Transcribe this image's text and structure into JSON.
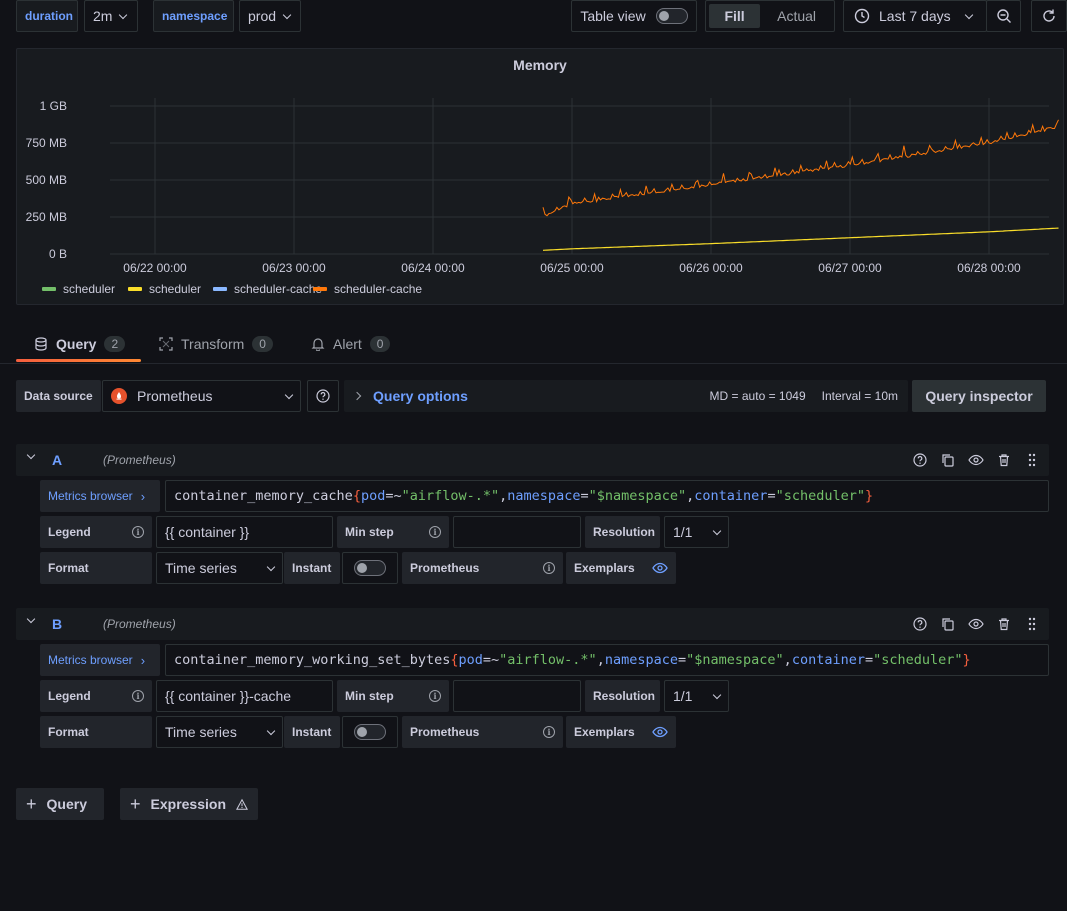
{
  "variables": [
    {
      "label": "duration",
      "value": "2m"
    },
    {
      "label": "namespace",
      "value": "prod"
    }
  ],
  "toolbar": {
    "table_view_label": "Table view",
    "fill_label": "Fill",
    "actual_label": "Actual",
    "time_range": "Last 7 days"
  },
  "panel": {
    "title": "Memory",
    "legend": [
      {
        "name": "scheduler",
        "color": "#73bf69"
      },
      {
        "name": "scheduler",
        "color": "#fade2a"
      },
      {
        "name": "scheduler-cache",
        "color": "#8ab8ff"
      },
      {
        "name": "scheduler-cache",
        "color": "#ff780a"
      }
    ]
  },
  "chart_data": {
    "type": "line",
    "title": "Memory",
    "y_ticks": [
      "1 GB",
      "750 MB",
      "500 MB",
      "250 MB",
      "0 B"
    ],
    "x_ticks": [
      "06/22 00:00",
      "06/23 00:00",
      "06/24 00:00",
      "06/25 00:00",
      "06/26 00:00",
      "06/27 00:00",
      "06/28 00:00"
    ],
    "ylim_mb": [
      0,
      1000
    ],
    "series": [
      {
        "name": "scheduler-cache",
        "color": "#ff780a",
        "x": [
          "06/24 19:00",
          "06/25 00:00",
          "06/26 00:00",
          "06/27 00:00",
          "06/28 00:00",
          "06/28 12:00"
        ],
        "values_mb": [
          255,
          340,
          470,
          600,
          750,
          860
        ]
      },
      {
        "name": "scheduler",
        "color": "#fade2a",
        "x": [
          "06/24 19:00",
          "06/25 00:00",
          "06/26 00:00",
          "06/27 00:00",
          "06/28 00:00",
          "06/28 12:00"
        ],
        "values_mb": [
          25,
          35,
          70,
          110,
          150,
          175
        ]
      }
    ],
    "grid": true,
    "legend_position": "bottom-left"
  },
  "tabs": [
    {
      "label": "Query",
      "count": "2"
    },
    {
      "label": "Transform",
      "count": "0"
    },
    {
      "label": "Alert",
      "count": "0"
    }
  ],
  "datasource": {
    "label": "Data source",
    "value": "Prometheus",
    "query_options": "Query options",
    "md": "MD = auto = 1049",
    "interval": "Interval = 10m",
    "inspector": "Query inspector"
  },
  "queries": [
    {
      "letter": "A",
      "ds": "(Prometheus)",
      "metrics_browser": "Metrics browser",
      "expr_metric": "container_memory_cache",
      "expr_pod_val": "\"airflow-.*\"",
      "expr_ns_val": "\"$namespace\"",
      "expr_container_val": "\"scheduler\"",
      "legend_label": "Legend",
      "legend_value": "{{ container }}",
      "min_step_label": "Min step",
      "min_step_value": "",
      "resolution_label": "Resolution",
      "resolution_value": "1/1",
      "format_label": "Format",
      "format_value": "Time series",
      "instant_label": "Instant",
      "type_label": "Prometheus",
      "exemplars_label": "Exemplars"
    },
    {
      "letter": "B",
      "ds": "(Prometheus)",
      "metrics_browser": "Metrics browser",
      "expr_metric": "container_memory_working_set_bytes",
      "expr_pod_val": "\"airflow-.*\"",
      "expr_ns_val": "\"$namespace\"",
      "expr_container_val": "\"scheduler\"",
      "legend_label": "Legend",
      "legend_value": "{{ container }}-cache",
      "min_step_label": "Min step",
      "min_step_value": "",
      "resolution_label": "Resolution",
      "resolution_value": "1/1",
      "format_label": "Format",
      "format_value": "Time series",
      "instant_label": "Instant",
      "type_label": "Prometheus",
      "exemplars_label": "Exemplars"
    }
  ],
  "expr_tokens": {
    "pod": "pod",
    "namespace": "namespace",
    "container": "container",
    "op_regex": "=~",
    "op_eq": "="
  },
  "add": {
    "query_label": "Query",
    "expression_label": "Expression"
  }
}
